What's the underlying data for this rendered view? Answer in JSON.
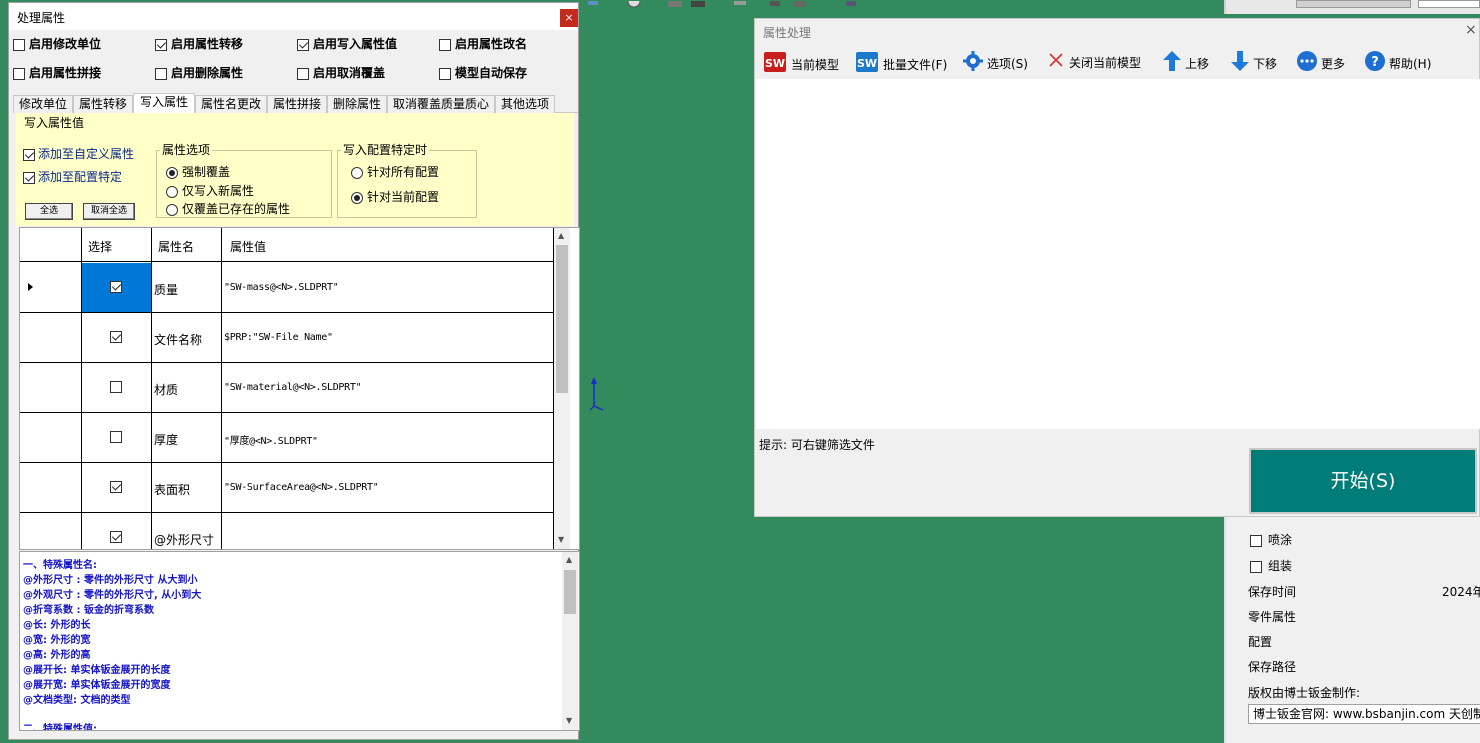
{
  "left_dialog": {
    "title": "处理属性",
    "close_label": "×",
    "options": [
      {
        "label": "启用修改单位",
        "checked": false
      },
      {
        "label": "启用属性转移",
        "checked": true
      },
      {
        "label": "启用写入属性值",
        "checked": true
      },
      {
        "label": "启用属性改名",
        "checked": false
      },
      {
        "label": "启用属性拼接",
        "checked": false
      },
      {
        "label": "启用删除属性",
        "checked": false
      },
      {
        "label": "启用取消覆盖",
        "checked": false
      },
      {
        "label": "模型自动保存",
        "checked": false
      }
    ],
    "tabs": [
      "修改单位",
      "属性转移",
      "写入属性",
      "属性名更改",
      "属性拼接",
      "删除属性",
      "取消覆盖质量质心",
      "其他选项"
    ],
    "active_tab": "写入属性",
    "panel": {
      "title": "写入属性值",
      "add_custom": "添加至自定义属性",
      "add_config": "添加至配置特定",
      "select_all": "全选",
      "deselect_all": "取消全选",
      "attr_options_title": "属性选项",
      "attr_options": [
        {
          "label": "强制覆盖",
          "selected": true
        },
        {
          "label": "仅写入新属性",
          "selected": false
        },
        {
          "label": "仅覆盖已存在的属性",
          "selected": false
        }
      ],
      "config_title": "写入配置特定时",
      "config_options": [
        {
          "label": "针对所有配置",
          "selected": false
        },
        {
          "label": "针对当前配置",
          "selected": true
        }
      ]
    },
    "grid": {
      "headers": [
        "选择",
        "属性名",
        "属性值"
      ],
      "rows": [
        {
          "checked": true,
          "name": "质量",
          "value": "\"SW-mass@<N>.SLDPRT\"",
          "current": true
        },
        {
          "checked": true,
          "name": "文件名称",
          "value": "$PRP:\"SW-File Name\"",
          "current": false
        },
        {
          "checked": false,
          "name": "材质",
          "value": "\"SW-material@<N>.SLDPRT\"",
          "current": false
        },
        {
          "checked": false,
          "name": "厚度",
          "value": "\"厚度@<N>.SLDPRT\"",
          "current": false
        },
        {
          "checked": true,
          "name": "表面积",
          "value": "\"SW-SurfaceArea@<N>.SLDPRT\"",
          "current": false
        },
        {
          "checked": true,
          "name": "@外形尺寸",
          "value": "",
          "current": false
        }
      ]
    },
    "notes": [
      "一、特殊属性名:",
      "@外形尺寸 : 零件的外形尺寸 从大到小",
      "@外观尺寸 : 零件的外形尺寸, 从小到大",
      "@折弯系数 : 钣金的折弯系数",
      "@长: 外形的长",
      "@宽: 外形的宽",
      "@高: 外形的高",
      "@展开长: 单实体钣金展开的长度",
      "@展开宽: 单实体钣金展开的宽度",
      "@文档类型: 文档的类型",
      "",
      "二、特殊属性值:"
    ]
  },
  "right_dialog": {
    "title": "属性处理",
    "close_label": "×",
    "toolbar": {
      "current_model": "当前模型",
      "batch_files": "批量文件(F)",
      "options": "选项(S)",
      "close_current": "关闭当前模型",
      "move_up": "上移",
      "move_down": "下移",
      "more": "更多",
      "help": "帮助(H)"
    },
    "hint": "提示: 可右键筛选文件",
    "start_label": "开始(S)"
  },
  "background_panel": {
    "items": [
      {
        "label": "喷涂",
        "checked": false
      },
      {
        "label": "组装",
        "checked": false
      }
    ],
    "save_time_label": "保存时间",
    "save_time_value": "2024年",
    "part_props": "零件属性",
    "config": "配置",
    "save_path": "保存路径",
    "copyright": "版权由博士钣金制作:",
    "website": "博士钣金官网: www.bsbanjin.com 天创制"
  },
  "colors": {
    "desktop": "#338a5c",
    "start_button": "#007d79",
    "note_text": "#1414c8",
    "panel_bg": "#ffffc8",
    "selected_cell": "#0078d7"
  }
}
